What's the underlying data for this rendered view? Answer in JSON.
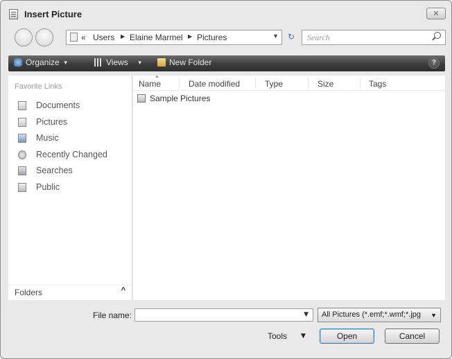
{
  "window": {
    "title": "Insert Picture",
    "close_symbol": "✕"
  },
  "address": {
    "chevron": "«",
    "crumbs": [
      "Users",
      "Elaine Marmel",
      "Pictures"
    ],
    "refresh_symbol": "↻"
  },
  "search": {
    "placeholder": "Search"
  },
  "toolbar": {
    "organize_label": "Organize",
    "views_label": "Views",
    "new_folder_label": "New Folder",
    "help_symbol": "?"
  },
  "nav": {
    "heading": "Favorite Links",
    "items": [
      {
        "label": "Documents",
        "icon": "documents-icon"
      },
      {
        "label": "Pictures",
        "icon": "pictures-icon"
      },
      {
        "label": "Music",
        "icon": "music-icon"
      },
      {
        "label": "Recently Changed",
        "icon": "recently-changed-icon"
      },
      {
        "label": "Searches",
        "icon": "searches-icon"
      },
      {
        "label": "Public",
        "icon": "public-icon"
      }
    ],
    "folders_label": "Folders",
    "folders_toggle": "^"
  },
  "file_list": {
    "columns": [
      "Name",
      "Date modified",
      "Type",
      "Size",
      "Tags"
    ],
    "rows": [
      {
        "name": "Sample Pictures",
        "icon": "folder-icon"
      }
    ]
  },
  "footer": {
    "file_name_label": "File name:",
    "file_name_value": "",
    "filter_value": "All Pictures (*.emf;*.wmf;*.jpg",
    "tools_label": "Tools",
    "open_label": "Open",
    "cancel_label": "Cancel"
  }
}
